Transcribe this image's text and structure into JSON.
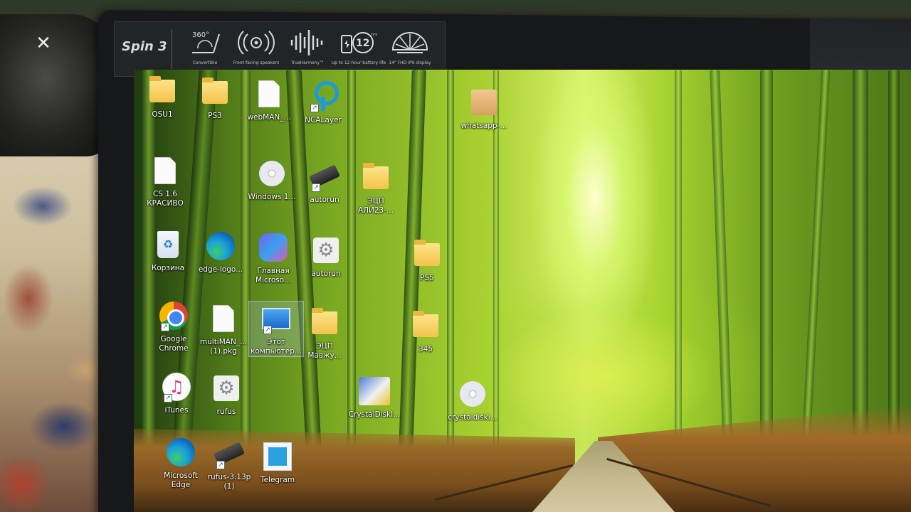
{
  "overlay": {
    "app_logo_icon": "capcut-logo-icon"
  },
  "sticker": {
    "brand": "Spin 3",
    "features": [
      {
        "icon": "convertible-icon",
        "glyph": "360°",
        "label": "Convertible"
      },
      {
        "icon": "speaker-icon",
        "glyph": "((◎))",
        "label": "Front-facing speakers"
      },
      {
        "icon": "sound-wave-icon",
        "glyph": "|||‖|||",
        "label": "TrueHarmony™"
      },
      {
        "icon": "battery-icon",
        "glyph": "12hrs",
        "label": "Up to 12-hour battery life"
      },
      {
        "icon": "display-icon",
        "glyph": "◠",
        "label": "14\" FHD IPS display"
      }
    ]
  },
  "desktop": {
    "icons": [
      {
        "id": "osu1",
        "label": "OSU1",
        "type": "folder"
      },
      {
        "id": "ps3",
        "label": "PS3",
        "type": "folder"
      },
      {
        "id": "webman",
        "label": "webMAN_...",
        "type": "doc"
      },
      {
        "id": "ncalayer",
        "label": "NCALayer",
        "type": "ncalayer"
      },
      {
        "id": "whatsapp",
        "label": "whatsapp-...",
        "type": "box"
      },
      {
        "id": "cs16",
        "label": "CS 1.6\nКРАСИВО",
        "type": "doc"
      },
      {
        "id": "windows",
        "label": "Windows 1...",
        "type": "cd"
      },
      {
        "id": "autorun1",
        "label": "autorun",
        "type": "usb"
      },
      {
        "id": "ecp-ali",
        "label": "ЭЦП\nАЛИ23-...",
        "type": "folder"
      },
      {
        "id": "recycle",
        "label": "Корзина",
        "type": "recycle"
      },
      {
        "id": "edge-logo",
        "label": "edge-logo...",
        "type": "edge"
      },
      {
        "id": "main-ms",
        "label": "Главная\nMicroso...",
        "type": "copilot"
      },
      {
        "id": "autorun2",
        "label": "autorun",
        "type": "gear"
      },
      {
        "id": "ps5",
        "label": "PS5",
        "type": "folder"
      },
      {
        "id": "chrome",
        "label": "Google\nChrome",
        "type": "chrome"
      },
      {
        "id": "multiman",
        "label": "multiMAN_...\n(1).pkg",
        "type": "doc"
      },
      {
        "id": "this-pc",
        "label": "Этот\nкомпьютер...",
        "type": "pc"
      },
      {
        "id": "ecp-mav",
        "label": "ЭЦП\nМавжу...",
        "type": "folder"
      },
      {
        "id": "f345",
        "label": "345",
        "type": "folder"
      },
      {
        "id": "itunes",
        "label": "iTunes",
        "type": "itunes"
      },
      {
        "id": "rufus",
        "label": "rufus",
        "type": "gear"
      },
      {
        "id": "crystaldisk1",
        "label": "CrystalDiskI...",
        "type": "crystal"
      },
      {
        "id": "crystaldisk2",
        "label": "crystaldiski...",
        "type": "cd"
      },
      {
        "id": "ms-edge",
        "label": "Microsoft\nEdge",
        "type": "edge"
      },
      {
        "id": "rufus313",
        "label": "rufus-3.13p\n(1)",
        "type": "usb"
      },
      {
        "id": "telegram",
        "label": "Telegram",
        "type": "telegram"
      }
    ]
  }
}
